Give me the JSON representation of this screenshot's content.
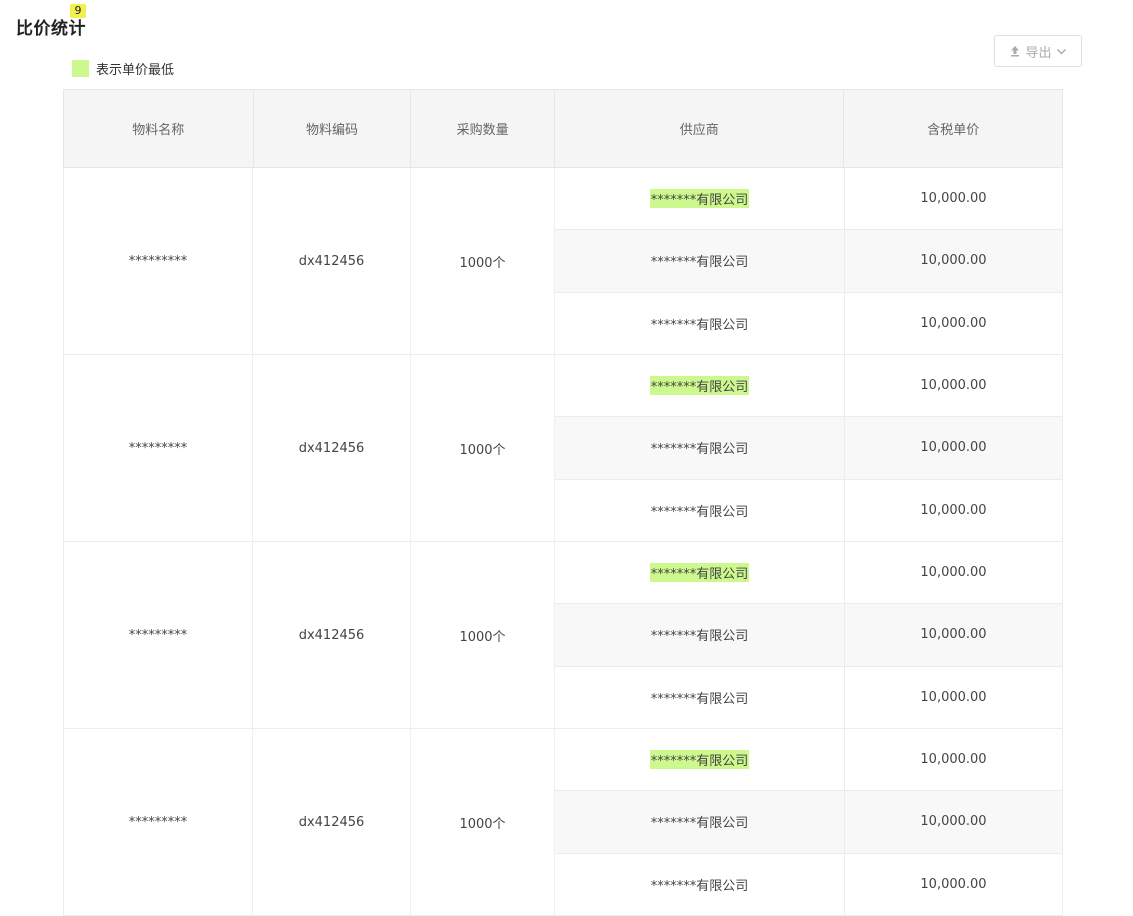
{
  "page": {
    "title": "比价统计",
    "badge": "9"
  },
  "toolbar": {
    "export_label": "导出"
  },
  "legend": {
    "label": "表示单价最低",
    "color": "#ccf88d"
  },
  "table": {
    "headers": [
      "物料名称",
      "物料编码",
      "采购数量",
      "供应商",
      "含税单价"
    ],
    "groups": [
      {
        "name": "*********",
        "code": "dx412456",
        "qty": "1000个",
        "rows": [
          {
            "supplier": "*******有限公司",
            "price": "10,000.00",
            "lowest": true
          },
          {
            "supplier": "*******有限公司",
            "price": "10,000.00",
            "lowest": false
          },
          {
            "supplier": "*******有限公司",
            "price": "10,000.00",
            "lowest": false
          }
        ]
      },
      {
        "name": "*********",
        "code": "dx412456",
        "qty": "1000个",
        "rows": [
          {
            "supplier": "*******有限公司",
            "price": "10,000.00",
            "lowest": true
          },
          {
            "supplier": "*******有限公司",
            "price": "10,000.00",
            "lowest": false
          },
          {
            "supplier": "*******有限公司",
            "price": "10,000.00",
            "lowest": false
          }
        ]
      },
      {
        "name": "*********",
        "code": "dx412456",
        "qty": "1000个",
        "rows": [
          {
            "supplier": "*******有限公司",
            "price": "10,000.00",
            "lowest": true
          },
          {
            "supplier": "*******有限公司",
            "price": "10,000.00",
            "lowest": false
          },
          {
            "supplier": "*******有限公司",
            "price": "10,000.00",
            "lowest": false
          }
        ]
      },
      {
        "name": "*********",
        "code": "dx412456",
        "qty": "1000个",
        "rows": [
          {
            "supplier": "*******有限公司",
            "price": "10,000.00",
            "lowest": true
          },
          {
            "supplier": "*******有限公司",
            "price": "10,000.00",
            "lowest": false
          },
          {
            "supplier": "*******有限公司",
            "price": "10,000.00",
            "lowest": false
          }
        ]
      }
    ]
  }
}
